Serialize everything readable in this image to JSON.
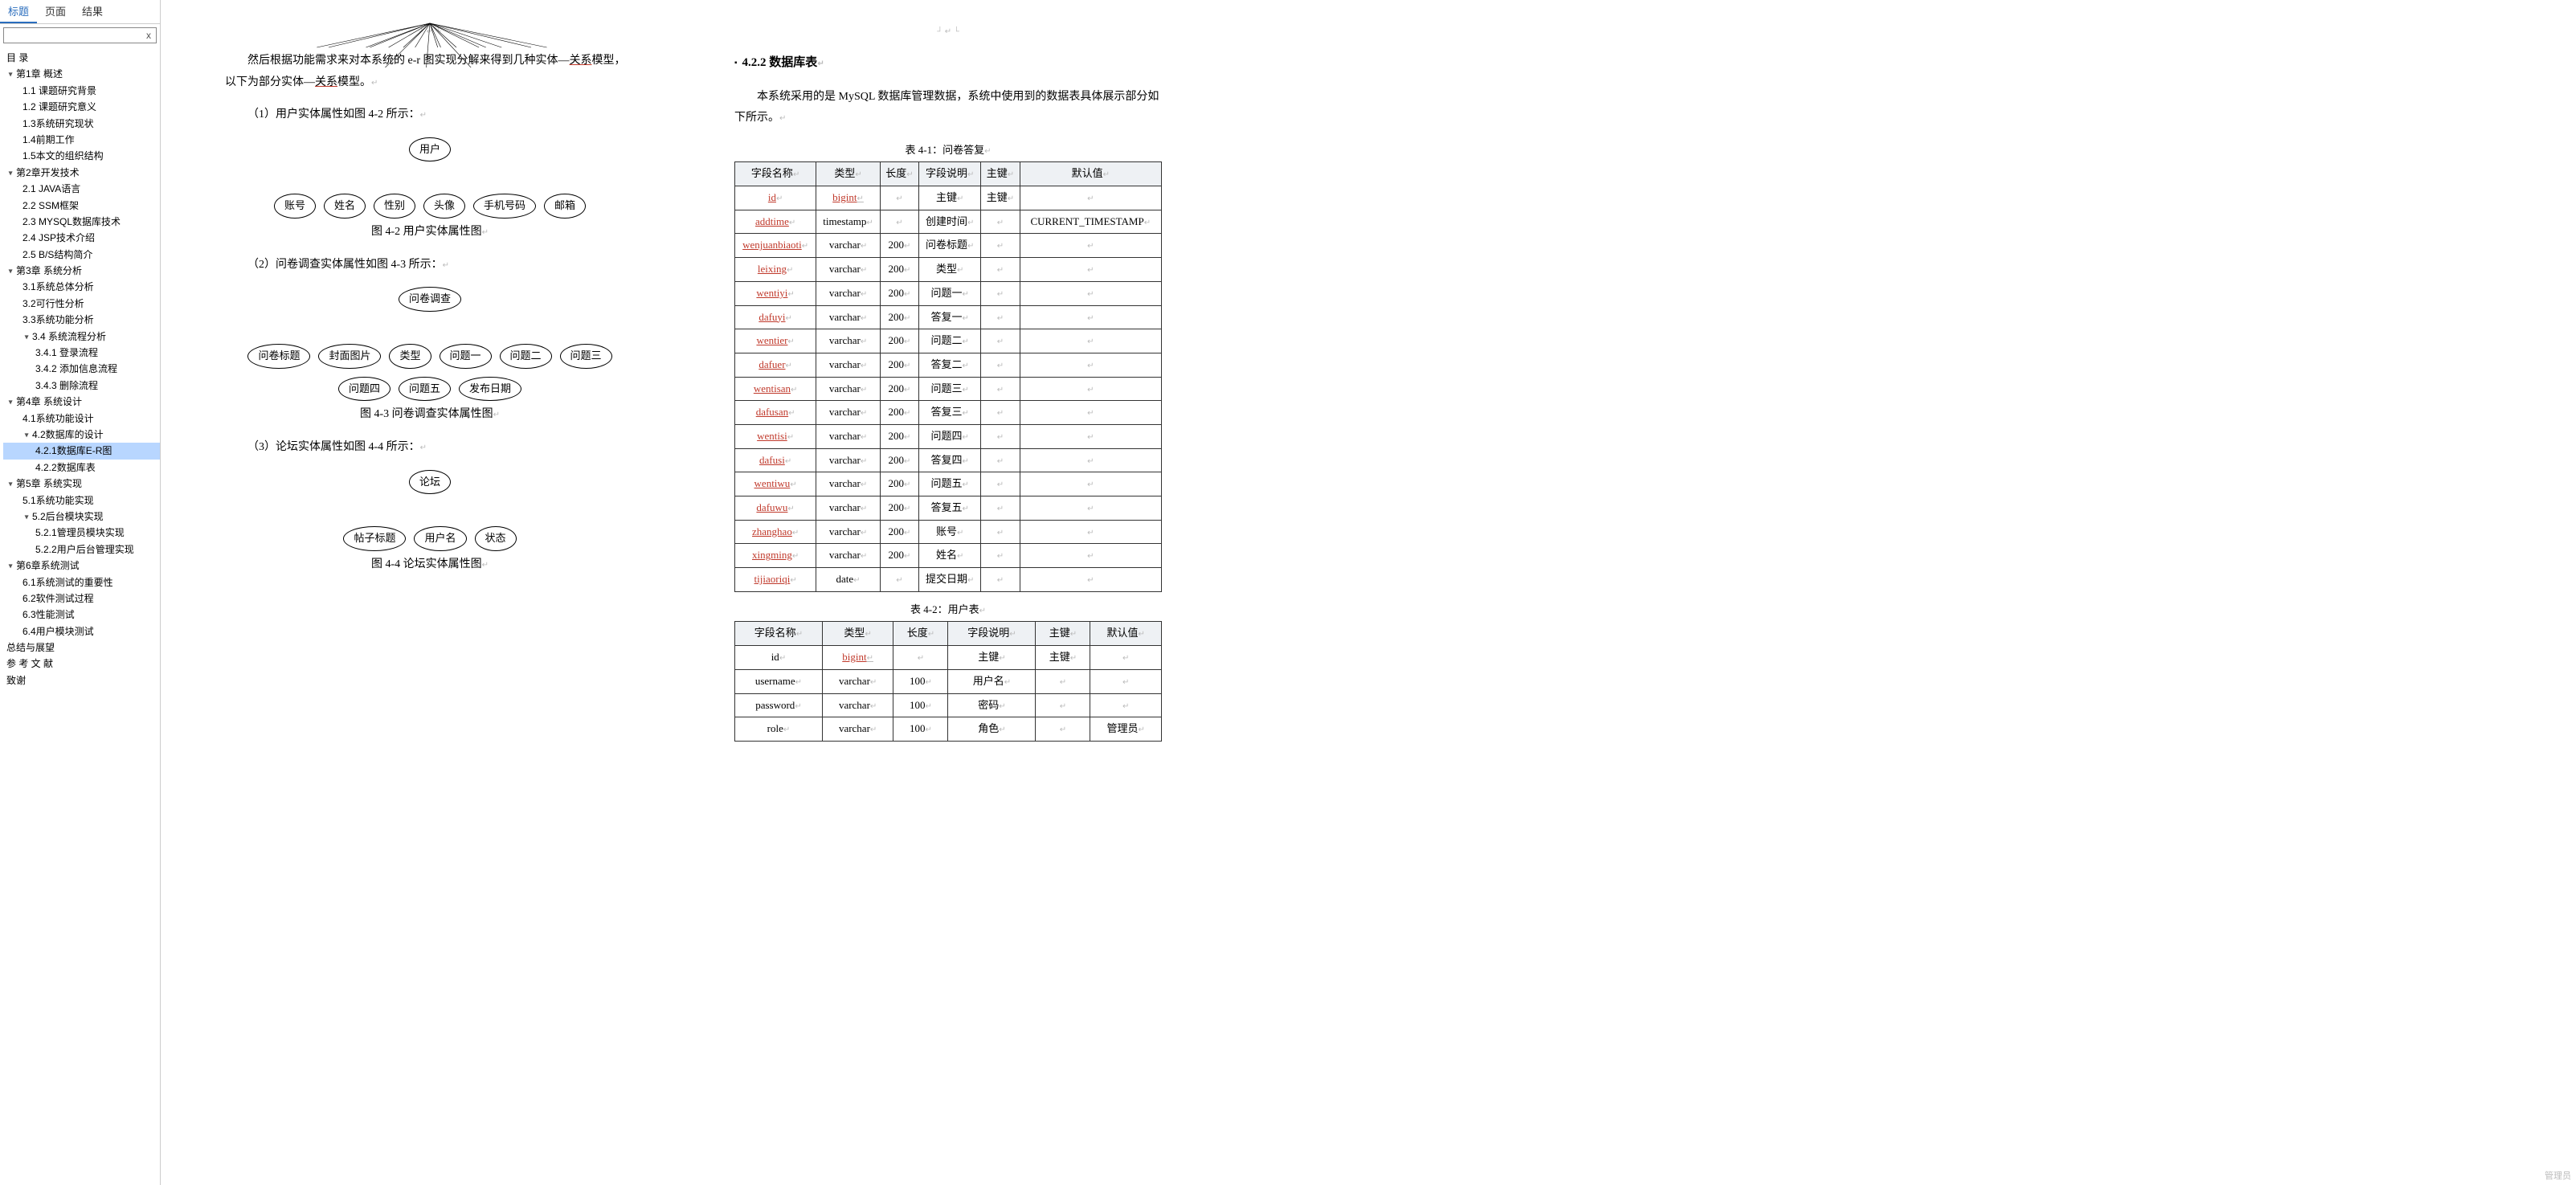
{
  "sidebar": {
    "tabs": [
      "标题",
      "页面",
      "结果"
    ],
    "active_tab": 0,
    "search_placeholder": "x",
    "toc": [
      {
        "lvl": 0,
        "tri": false,
        "label": "目 录"
      },
      {
        "lvl": 1,
        "tri": true,
        "label": "第1章 概述"
      },
      {
        "lvl": 2,
        "tri": false,
        "label": "1.1 课题研究背景"
      },
      {
        "lvl": 2,
        "tri": false,
        "label": "1.2 课题研究意义"
      },
      {
        "lvl": 2,
        "tri": false,
        "label": "1.3系统研究现状"
      },
      {
        "lvl": 2,
        "tri": false,
        "label": "1.4前期工作"
      },
      {
        "lvl": 2,
        "tri": false,
        "label": "1.5本文的组织结构"
      },
      {
        "lvl": 1,
        "tri": true,
        "label": "第2章开发技术"
      },
      {
        "lvl": 2,
        "tri": false,
        "label": "2.1 JAVA语言"
      },
      {
        "lvl": 2,
        "tri": false,
        "label": "2.2 SSM框架"
      },
      {
        "lvl": 2,
        "tri": false,
        "label": "2.3 MYSQL数据库技术"
      },
      {
        "lvl": 2,
        "tri": false,
        "label": "2.4 JSP技术介绍"
      },
      {
        "lvl": 2,
        "tri": false,
        "label": "2.5 B/S结构简介"
      },
      {
        "lvl": 1,
        "tri": true,
        "label": "第3章 系统分析"
      },
      {
        "lvl": 2,
        "tri": false,
        "label": "3.1系统总体分析"
      },
      {
        "lvl": 2,
        "tri": false,
        "label": "3.2可行性分析"
      },
      {
        "lvl": 2,
        "tri": false,
        "label": "3.3系统功能分析"
      },
      {
        "lvl": 2,
        "tri": true,
        "label": "3.4 系统流程分析"
      },
      {
        "lvl": 3,
        "tri": false,
        "label": "3.4.1 登录流程"
      },
      {
        "lvl": 3,
        "tri": false,
        "label": "3.4.2 添加信息流程"
      },
      {
        "lvl": 3,
        "tri": false,
        "label": "3.4.3 删除流程"
      },
      {
        "lvl": 1,
        "tri": true,
        "label": "第4章 系统设计"
      },
      {
        "lvl": 2,
        "tri": false,
        "label": "4.1系统功能设计"
      },
      {
        "lvl": 2,
        "tri": true,
        "label": "4.2数据库的设计"
      },
      {
        "lvl": 3,
        "tri": false,
        "label": "4.2.1数据库E-R图",
        "sel": true
      },
      {
        "lvl": 3,
        "tri": false,
        "label": "4.2.2数据库表"
      },
      {
        "lvl": 1,
        "tri": true,
        "label": "第5章 系统实现"
      },
      {
        "lvl": 2,
        "tri": false,
        "label": "5.1系统功能实现"
      },
      {
        "lvl": 2,
        "tri": true,
        "label": "5.2后台模块实现"
      },
      {
        "lvl": 3,
        "tri": false,
        "label": "5.2.1管理员模块实现"
      },
      {
        "lvl": 3,
        "tri": false,
        "label": "5.2.2用户后台管理实现"
      },
      {
        "lvl": 1,
        "tri": true,
        "label": "第6章系统测试"
      },
      {
        "lvl": 2,
        "tri": false,
        "label": "6.1系统测试的重要性"
      },
      {
        "lvl": 2,
        "tri": false,
        "label": "6.2软件测试过程"
      },
      {
        "lvl": 2,
        "tri": false,
        "label": "6.3性能测试"
      },
      {
        "lvl": 2,
        "tri": false,
        "label": "6.4用户模块测试"
      },
      {
        "lvl": 0,
        "tri": false,
        "label": "总结与展望"
      },
      {
        "lvl": 0,
        "tri": false,
        "label": "参 考 文 献"
      },
      {
        "lvl": 0,
        "tri": false,
        "label": "致谢"
      }
    ]
  },
  "page1": {
    "p1a": "然后根据功能需求来对本系统的 e-r 图实现分解来得到几种实体—",
    "p1b": "关系",
    "p1c": "模型，以下为部分实体—",
    "p1d": "关系",
    "p1e": "模型。",
    "l1": "（1）用户实体属性如图 4-2 所示：",
    "d1_root": "用户",
    "d1_children": [
      "账号",
      "姓名",
      "性别",
      "头像",
      "手机号码",
      "邮箱"
    ],
    "cap1": "图 4-2 用户实体属性图",
    "l2": "（2）问卷调查实体属性如图 4-3 所示：",
    "d2_root": "问卷调查",
    "d2_children": [
      "问卷标题",
      "封面图片",
      "类型",
      "问题一",
      "问题二",
      "问题三",
      "问题四",
      "问题五",
      "发布日期"
    ],
    "cap2": "图 4-3 问卷调查实体属性图",
    "l3": "（3）论坛实体属性如图 4-4 所示：",
    "d3_root": "论坛",
    "d3_children": [
      "帖子标题",
      "用户名",
      "状态"
    ],
    "cap3": "图 4-4 论坛实体属性图"
  },
  "page2": {
    "head": "4.2.2 数据库表",
    "p1": "本系统采用的是 MySQL 数据库管理数据，系统中使用到的数据表具体展示部分如下所示。",
    "t1_cap": "表 4-1：问卷答复",
    "cols": [
      "字段名称",
      "类型",
      "长度",
      "字段说明",
      "主键",
      "默认值"
    ],
    "t1_rows": [
      [
        "id",
        "bigint",
        "",
        "主键",
        "主键",
        ""
      ],
      [
        "addtime",
        "timestamp",
        "",
        "创建时间",
        "",
        "CURRENT_TIMESTAMP"
      ],
      [
        "wenjuanbiaoti",
        "varchar",
        "200",
        "问卷标题",
        "",
        ""
      ],
      [
        "leixing",
        "varchar",
        "200",
        "类型",
        "",
        ""
      ],
      [
        "wentiyi",
        "varchar",
        "200",
        "问题一",
        "",
        ""
      ],
      [
        "dafuyi",
        "varchar",
        "200",
        "答复一",
        "",
        ""
      ],
      [
        "wentier",
        "varchar",
        "200",
        "问题二",
        "",
        ""
      ],
      [
        "dafuer",
        "varchar",
        "200",
        "答复二",
        "",
        ""
      ],
      [
        "wentisan",
        "varchar",
        "200",
        "问题三",
        "",
        ""
      ],
      [
        "dafusan",
        "varchar",
        "200",
        "答复三",
        "",
        ""
      ],
      [
        "wentisi",
        "varchar",
        "200",
        "问题四",
        "",
        ""
      ],
      [
        "dafusi",
        "varchar",
        "200",
        "答复四",
        "",
        ""
      ],
      [
        "wentiwu",
        "varchar",
        "200",
        "问题五",
        "",
        ""
      ],
      [
        "dafuwu",
        "varchar",
        "200",
        "答复五",
        "",
        ""
      ],
      [
        "zhanghao",
        "varchar",
        "200",
        "账号",
        "",
        ""
      ],
      [
        "xingming",
        "varchar",
        "200",
        "姓名",
        "",
        ""
      ],
      [
        "tijiaoriqi",
        "date",
        "",
        "提交日期",
        "",
        ""
      ]
    ],
    "t1_red": [
      0,
      1,
      2,
      3,
      4,
      5,
      6,
      7,
      8,
      9,
      10,
      11,
      12,
      13,
      14,
      15,
      16
    ],
    "t2_cap": "表 4-2：用户表",
    "t2_rows": [
      [
        "id",
        "bigint",
        "",
        "主键",
        "主键",
        ""
      ],
      [
        "username",
        "varchar",
        "100",
        "用户名",
        "",
        ""
      ],
      [
        "password",
        "varchar",
        "100",
        "密码",
        "",
        ""
      ],
      [
        "role",
        "varchar",
        "100",
        "角色",
        "",
        "管理员"
      ]
    ]
  },
  "watermark": "管理员"
}
